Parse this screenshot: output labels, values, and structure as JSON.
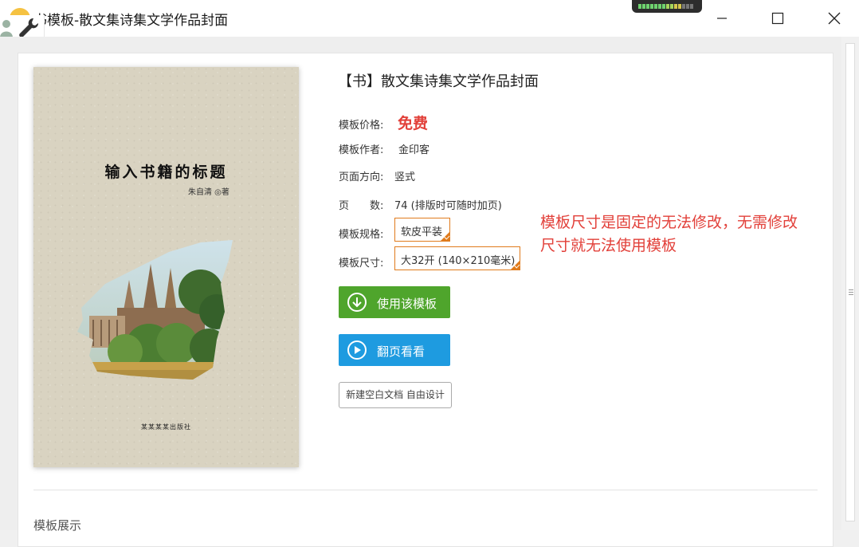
{
  "window": {
    "title": "书模板-散文集诗集文学作品封面",
    "controls": {
      "minimize": "minimize-icon",
      "maximize": "maximize-icon",
      "close": "close-icon"
    }
  },
  "cover": {
    "title": "输入书籍的标题",
    "author": "朱自清 ◎著",
    "publisher": "某某某某出版社",
    "background_color": "#d9d3c1"
  },
  "detail": {
    "heading": "【书】散文集诗集文学作品封面",
    "price_label": "模板价格:",
    "price_value": "免费",
    "author_label": "模板作者:",
    "author_value": "金印客",
    "orientation_label": "页面方向:",
    "orientation_value": "竖式",
    "pages_label": "页　　数:",
    "pages_value": "74 (排版时可随时加页)",
    "spec_label": "模板规格:",
    "spec_value": "软皮平装",
    "size_label": "模板尺寸:",
    "size_value": "大32开 (140×210毫米)",
    "note": "模板尺寸是固定的无法修改，无需修改尺寸就无法使用模板"
  },
  "actions": {
    "use_label": "使用该模板",
    "flip_label": "翻页看看",
    "blank_label": "新建空白文档 自由设计"
  },
  "section": {
    "showcase_label": "模板展示"
  },
  "colors": {
    "price_red": "#e2403a",
    "select_orange": "#e07b1c",
    "use_green": "#4fa52c",
    "flip_blue": "#1e9be0"
  }
}
